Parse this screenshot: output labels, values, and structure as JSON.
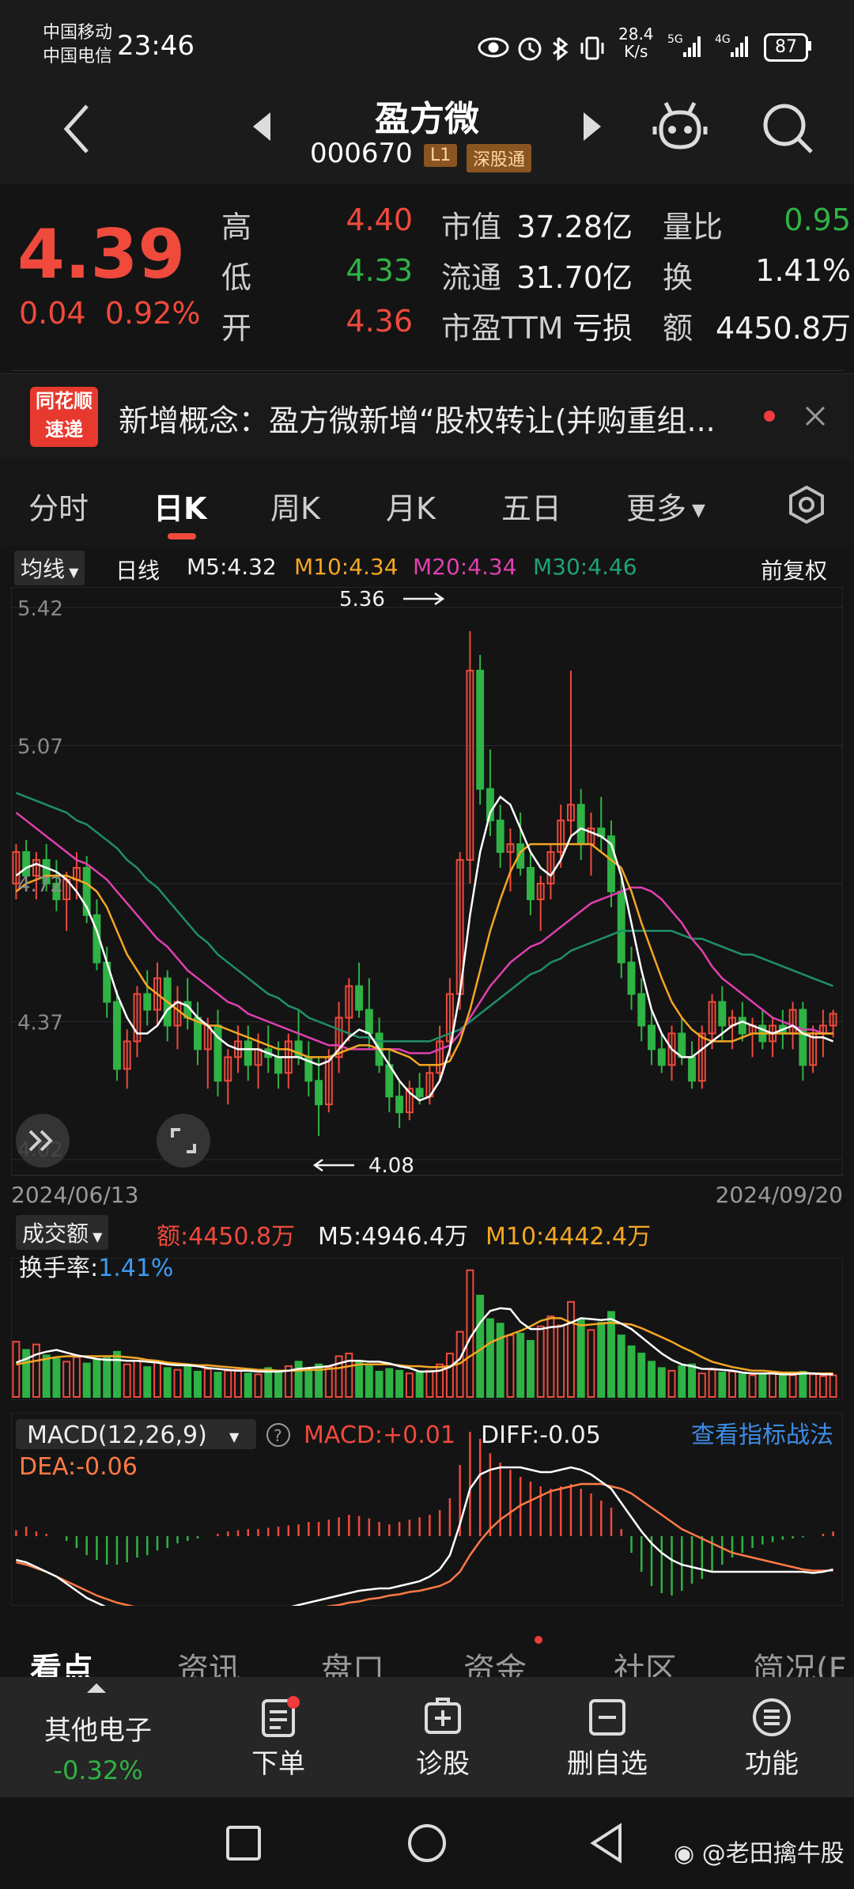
{
  "status_bar": {
    "carrier1": "中国移动",
    "carrier2": "中国电信",
    "time": "23:46",
    "net_speed": "28.4",
    "net_unit": "K/s",
    "sig1": "5G",
    "sig2": "4G",
    "battery": "87"
  },
  "header": {
    "name": "盈方微",
    "code": "000670",
    "tag_level": "L1",
    "tag_market": "深股通"
  },
  "quote": {
    "price": "4.39",
    "change": "0.04",
    "change_pct": "0.92%",
    "high_label": "高",
    "high": "4.40",
    "low_label": "低",
    "low": "4.33",
    "open_label": "开",
    "open": "4.36",
    "mcap_label": "市值",
    "mcap": "37.28亿",
    "float_label": "流通",
    "float": "31.70亿",
    "pe_label": "市盈TTM",
    "pe": "亏损",
    "vr_label": "量比",
    "vr": "0.95",
    "turn_label": "换",
    "turn": "1.41%",
    "amt_label": "额",
    "amt": "4450.8万"
  },
  "news": {
    "logo_top": "同花顺",
    "logo_bottom": "速递",
    "text": "新增概念：盈方微新增“股权转让(并购重组..."
  },
  "tabs": [
    "分时",
    "日K",
    "周K",
    "月K",
    "五日",
    "更多"
  ],
  "ma_legend": {
    "dropdown": "均线",
    "period": "日线",
    "m5": "M5:4.32",
    "m10": "M10:4.34",
    "m20": "M20:4.34",
    "m30": "M30:4.46",
    "adjust": "前复权"
  },
  "colors": {
    "up": "#ef4a3c",
    "down": "#2fb345",
    "m5": "#ffffff",
    "m10": "#f5a623",
    "m20": "#e040b0",
    "m30": "#1f8f6a",
    "link": "#3c8ce7"
  },
  "chart_data": {
    "type": "candlestick",
    "y_ticks": [
      "5.42",
      "5.07",
      "4.72",
      "4.37",
      "4.02"
    ],
    "ylim": [
      4.02,
      5.42
    ],
    "max_label": "5.36",
    "min_label": "4.08",
    "start_date": "2024/06/13",
    "end_date": "2024/09/20",
    "ohlc": [
      [
        4.72,
        4.82,
        4.68,
        4.8
      ],
      [
        4.8,
        4.83,
        4.7,
        4.74
      ],
      [
        4.74,
        4.8,
        4.68,
        4.78
      ],
      [
        4.78,
        4.82,
        4.7,
        4.72
      ],
      [
        4.72,
        4.78,
        4.65,
        4.68
      ],
      [
        4.68,
        4.75,
        4.6,
        4.73
      ],
      [
        4.73,
        4.8,
        4.68,
        4.76
      ],
      [
        4.76,
        4.79,
        4.62,
        4.64
      ],
      [
        4.64,
        4.68,
        4.5,
        4.52
      ],
      [
        4.52,
        4.56,
        4.38,
        4.42
      ],
      [
        4.42,
        4.45,
        4.22,
        4.25
      ],
      [
        4.25,
        4.35,
        4.2,
        4.32
      ],
      [
        4.32,
        4.46,
        4.28,
        4.44
      ],
      [
        4.44,
        4.5,
        4.36,
        4.4
      ],
      [
        4.4,
        4.52,
        4.36,
        4.48
      ],
      [
        4.48,
        4.5,
        4.32,
        4.36
      ],
      [
        4.36,
        4.46,
        4.3,
        4.42
      ],
      [
        4.42,
        4.48,
        4.35,
        4.38
      ],
      [
        4.38,
        4.42,
        4.26,
        4.3
      ],
      [
        4.3,
        4.38,
        4.2,
        4.36
      ],
      [
        4.36,
        4.4,
        4.18,
        4.22
      ],
      [
        4.22,
        4.3,
        4.16,
        4.28
      ],
      [
        4.28,
        4.36,
        4.24,
        4.32
      ],
      [
        4.32,
        4.36,
        4.22,
        4.26
      ],
      [
        4.26,
        4.34,
        4.2,
        4.3
      ],
      [
        4.3,
        4.36,
        4.24,
        4.28
      ],
      [
        4.28,
        4.32,
        4.2,
        4.24
      ],
      [
        4.24,
        4.34,
        4.2,
        4.32
      ],
      [
        4.32,
        4.4,
        4.26,
        4.28
      ],
      [
        4.28,
        4.32,
        4.18,
        4.22
      ],
      [
        4.22,
        4.28,
        4.08,
        4.16
      ],
      [
        4.16,
        4.3,
        4.14,
        4.28
      ],
      [
        4.28,
        4.42,
        4.24,
        4.38
      ],
      [
        4.38,
        4.48,
        4.32,
        4.46
      ],
      [
        4.46,
        4.52,
        4.38,
        4.4
      ],
      [
        4.4,
        4.48,
        4.3,
        4.34
      ],
      [
        4.34,
        4.38,
        4.24,
        4.26
      ],
      [
        4.26,
        4.3,
        4.14,
        4.18
      ],
      [
        4.18,
        4.22,
        4.1,
        4.14
      ],
      [
        4.14,
        4.22,
        4.12,
        4.2
      ],
      [
        4.2,
        4.24,
        4.16,
        4.18
      ],
      [
        4.18,
        4.26,
        4.16,
        4.24
      ],
      [
        4.24,
        4.36,
        4.22,
        4.32
      ],
      [
        4.32,
        4.48,
        4.28,
        4.44
      ],
      [
        4.44,
        4.8,
        4.4,
        4.78
      ],
      [
        4.78,
        5.36,
        4.72,
        5.26
      ],
      [
        5.26,
        5.3,
        4.92,
        4.96
      ],
      [
        4.96,
        5.06,
        4.84,
        4.88
      ],
      [
        4.88,
        4.92,
        4.76,
        4.8
      ],
      [
        4.8,
        4.86,
        4.7,
        4.82
      ],
      [
        4.82,
        4.9,
        4.74,
        4.76
      ],
      [
        4.76,
        4.8,
        4.64,
        4.68
      ],
      [
        4.68,
        4.74,
        4.6,
        4.72
      ],
      [
        4.72,
        4.82,
        4.68,
        4.8
      ],
      [
        4.8,
        4.92,
        4.76,
        4.88
      ],
      [
        4.88,
        5.26,
        4.84,
        4.92
      ],
      [
        4.92,
        4.96,
        4.78,
        4.82
      ],
      [
        4.82,
        4.9,
        4.74,
        4.86
      ],
      [
        4.86,
        4.94,
        4.8,
        4.84
      ],
      [
        4.84,
        4.88,
        4.66,
        4.7
      ],
      [
        4.7,
        4.74,
        4.48,
        4.52
      ],
      [
        4.52,
        4.56,
        4.4,
        4.44
      ],
      [
        4.44,
        4.48,
        4.32,
        4.36
      ],
      [
        4.36,
        4.4,
        4.26,
        4.3
      ],
      [
        4.3,
        4.34,
        4.24,
        4.26
      ],
      [
        4.26,
        4.36,
        4.22,
        4.34
      ],
      [
        4.34,
        4.38,
        4.26,
        4.28
      ],
      [
        4.28,
        4.32,
        4.2,
        4.22
      ],
      [
        4.22,
        4.36,
        4.2,
        4.34
      ],
      [
        4.34,
        4.44,
        4.3,
        4.42
      ],
      [
        4.42,
        4.46,
        4.32,
        4.36
      ],
      [
        4.36,
        4.4,
        4.3,
        4.38
      ],
      [
        4.38,
        4.42,
        4.32,
        4.34
      ],
      [
        4.34,
        4.38,
        4.28,
        4.36
      ],
      [
        4.36,
        4.4,
        4.3,
        4.32
      ],
      [
        4.32,
        4.38,
        4.28,
        4.36
      ],
      [
        4.36,
        4.4,
        4.3,
        4.34
      ],
      [
        4.34,
        4.42,
        4.3,
        4.4
      ],
      [
        4.4,
        4.42,
        4.22,
        4.26
      ],
      [
        4.26,
        4.36,
        4.24,
        4.34
      ],
      [
        4.34,
        4.4,
        4.28,
        4.36
      ],
      [
        4.36,
        4.4,
        4.33,
        4.39
      ]
    ],
    "ma5": [
      4.74,
      4.76,
      4.77,
      4.76,
      4.75,
      4.73,
      4.7,
      4.66,
      4.6,
      4.52,
      4.44,
      4.38,
      4.34,
      4.34,
      4.36,
      4.4,
      4.42,
      4.41,
      4.38,
      4.36,
      4.33,
      4.31,
      4.3,
      4.3,
      4.3,
      4.29,
      4.28,
      4.28,
      4.28,
      4.27,
      4.26,
      4.27,
      4.3,
      4.33,
      4.35,
      4.34,
      4.3,
      4.26,
      4.22,
      4.19,
      4.17,
      4.18,
      4.22,
      4.3,
      4.44,
      4.64,
      4.8,
      4.9,
      4.94,
      4.92,
      4.86,
      4.8,
      4.76,
      4.74,
      4.78,
      4.84,
      4.86,
      4.85,
      4.84,
      4.82,
      4.74,
      4.62,
      4.5,
      4.4,
      4.34,
      4.3,
      4.28,
      4.28,
      4.3,
      4.32,
      4.34,
      4.36,
      4.37,
      4.36,
      4.35,
      4.34,
      4.35,
      4.36,
      4.34,
      4.33,
      4.33,
      4.32
    ],
    "ma10": [
      4.7,
      4.72,
      4.73,
      4.74,
      4.74,
      4.74,
      4.73,
      4.72,
      4.7,
      4.66,
      4.6,
      4.54,
      4.5,
      4.46,
      4.44,
      4.42,
      4.4,
      4.38,
      4.37,
      4.36,
      4.36,
      4.35,
      4.34,
      4.33,
      4.32,
      4.31,
      4.3,
      4.3,
      4.29,
      4.28,
      4.28,
      4.28,
      4.29,
      4.3,
      4.31,
      4.31,
      4.3,
      4.3,
      4.29,
      4.28,
      4.26,
      4.26,
      4.26,
      4.27,
      4.32,
      4.4,
      4.5,
      4.6,
      4.68,
      4.75,
      4.8,
      4.82,
      4.82,
      4.82,
      4.82,
      4.82,
      4.82,
      4.82,
      4.8,
      4.78,
      4.76,
      4.7,
      4.62,
      4.55,
      4.48,
      4.42,
      4.38,
      4.35,
      4.33,
      4.32,
      4.32,
      4.32,
      4.33,
      4.34,
      4.34,
      4.34,
      4.34,
      4.34,
      4.34,
      4.34,
      4.34,
      4.34
    ],
    "ma20": [
      4.9,
      4.88,
      4.86,
      4.84,
      4.82,
      4.8,
      4.78,
      4.77,
      4.75,
      4.73,
      4.7,
      4.67,
      4.64,
      4.61,
      4.58,
      4.56,
      4.53,
      4.5,
      4.48,
      4.46,
      4.44,
      4.42,
      4.41,
      4.39,
      4.38,
      4.37,
      4.36,
      4.35,
      4.34,
      4.33,
      4.32,
      4.31,
      4.31,
      4.3,
      4.3,
      4.3,
      4.3,
      4.3,
      4.3,
      4.29,
      4.29,
      4.29,
      4.3,
      4.31,
      4.34,
      4.38,
      4.42,
      4.46,
      4.49,
      4.52,
      4.54,
      4.56,
      4.57,
      4.59,
      4.61,
      4.63,
      4.65,
      4.67,
      4.68,
      4.69,
      4.7,
      4.71,
      4.71,
      4.7,
      4.68,
      4.65,
      4.62,
      4.58,
      4.55,
      4.51,
      4.48,
      4.46,
      4.44,
      4.42,
      4.4,
      4.38,
      4.37,
      4.36,
      4.35,
      4.35,
      4.34,
      4.34
    ],
    "ma30": [
      4.95,
      4.94,
      4.93,
      4.92,
      4.91,
      4.9,
      4.88,
      4.87,
      4.85,
      4.83,
      4.81,
      4.78,
      4.76,
      4.73,
      4.71,
      4.68,
      4.65,
      4.62,
      4.59,
      4.57,
      4.54,
      4.52,
      4.5,
      4.48,
      4.46,
      4.44,
      4.43,
      4.41,
      4.4,
      4.38,
      4.37,
      4.36,
      4.35,
      4.34,
      4.33,
      4.33,
      4.32,
      4.32,
      4.32,
      4.32,
      4.32,
      4.32,
      4.33,
      4.34,
      4.35,
      4.37,
      4.39,
      4.41,
      4.43,
      4.45,
      4.47,
      4.49,
      4.5,
      4.52,
      4.53,
      4.55,
      4.56,
      4.57,
      4.58,
      4.59,
      4.6,
      4.6,
      4.6,
      4.6,
      4.6,
      4.6,
      4.59,
      4.58,
      4.58,
      4.57,
      4.56,
      4.55,
      4.54,
      4.54,
      4.53,
      4.52,
      4.51,
      4.5,
      4.49,
      4.48,
      4.47,
      4.46
    ]
  },
  "volume": {
    "dropdown": "成交额",
    "amount": "额:4450.8万",
    "m5": "M5:4946.4万",
    "m10": "M10:4442.4万",
    "turnover_label": "换手率:",
    "turnover": "1.41%",
    "values": [
      6.1,
      5.2,
      5.8,
      4.6,
      4.2,
      3.9,
      4.4,
      3.7,
      4.1,
      4.3,
      5.0,
      3.6,
      4.0,
      3.3,
      3.8,
      3.2,
      3.0,
      3.4,
      2.8,
      3.1,
      2.7,
      2.9,
      3.0,
      2.6,
      2.5,
      3.2,
      2.8,
      3.4,
      3.9,
      3.0,
      3.6,
      3.3,
      4.5,
      4.8,
      3.9,
      3.4,
      2.8,
      3.1,
      2.9,
      2.6,
      2.7,
      2.9,
      3.6,
      4.8,
      7.2,
      14.0,
      11.2,
      8.6,
      8.1,
      6.8,
      7.0,
      6.2,
      7.8,
      8.9,
      7.9,
      10.5,
      8.6,
      7.4,
      8.2,
      9.4,
      6.8,
      5.6,
      4.8,
      3.9,
      3.2,
      2.9,
      3.4,
      3.6,
      2.6,
      3.0,
      2.7,
      2.8,
      2.5,
      2.4,
      2.6,
      2.7,
      2.5,
      2.4,
      2.8,
      2.5,
      2.3,
      2.4
    ],
    "ma5": [
      3.8,
      4.2,
      4.7,
      5.0,
      5.2,
      4.9,
      4.6,
      4.4,
      4.2,
      4.1,
      4.1,
      4.0,
      4.0,
      3.9,
      3.8,
      3.6,
      3.5,
      3.5,
      3.4,
      3.2,
      3.1,
      3.0,
      2.9,
      2.9,
      2.8,
      2.8,
      2.8,
      2.9,
      3.1,
      3.2,
      3.3,
      3.4,
      3.7,
      4.0,
      4.0,
      3.9,
      3.9,
      3.7,
      3.4,
      3.2,
      2.8,
      2.8,
      2.9,
      3.3,
      4.2,
      6.5,
      8.2,
      9.5,
      9.8,
      9.7,
      8.3,
      7.5,
      7.5,
      7.7,
      7.8,
      8.2,
      8.7,
      8.6,
      8.5,
      8.6,
      8.1,
      7.5,
      6.6,
      5.7,
      4.8,
      4.1,
      3.6,
      3.4,
      3.1,
      3.1,
      3.0,
      2.9,
      2.7,
      2.6,
      2.6,
      2.6,
      2.5,
      2.5,
      2.6,
      2.6,
      2.5,
      2.5
    ],
    "ma10": [
      3.6,
      3.8,
      4.0,
      4.2,
      4.4,
      4.5,
      4.5,
      4.5,
      4.5,
      4.5,
      4.5,
      4.4,
      4.3,
      4.1,
      4.0,
      3.8,
      3.7,
      3.6,
      3.5,
      3.5,
      3.4,
      3.3,
      3.2,
      3.1,
      3.0,
      3.0,
      2.9,
      2.9,
      2.9,
      3.0,
      3.0,
      3.1,
      3.2,
      3.4,
      3.6,
      3.6,
      3.6,
      3.6,
      3.5,
      3.4,
      3.4,
      3.3,
      3.3,
      3.4,
      3.7,
      4.5,
      5.2,
      6.0,
      6.5,
      6.9,
      7.3,
      7.8,
      8.4,
      8.7,
      8.7,
      8.2,
      7.9,
      8.0,
      8.1,
      8.2,
      8.1,
      8.0,
      7.6,
      7.1,
      6.6,
      6.1,
      5.5,
      5.0,
      4.4,
      3.9,
      3.6,
      3.3,
      3.1,
      2.9,
      2.9,
      2.8,
      2.7,
      2.7,
      2.7,
      2.6,
      2.6,
      2.6
    ]
  },
  "macd": {
    "dropdown": "MACD(12,26,9)",
    "help": "?",
    "macd": "MACD:+0.01",
    "diff": "DIFF:-0.05",
    "dea": "DEA:-0.06",
    "link": "查看指标战法",
    "hist": [
      0.005,
      0.008,
      0.004,
      0.002,
      0.0,
      -0.004,
      -0.01,
      -0.016,
      -0.02,
      -0.024,
      -0.024,
      -0.022,
      -0.018,
      -0.016,
      -0.012,
      -0.01,
      -0.006,
      -0.004,
      -0.002,
      0.0,
      0.002,
      0.004,
      0.005,
      0.006,
      0.006,
      0.007,
      0.008,
      0.009,
      0.01,
      0.012,
      0.012,
      0.014,
      0.016,
      0.018,
      0.017,
      0.015,
      0.012,
      0.01,
      0.012,
      0.014,
      0.016,
      0.018,
      0.022,
      0.032,
      0.06,
      0.088,
      0.082,
      0.07,
      0.062,
      0.056,
      0.05,
      0.046,
      0.042,
      0.04,
      0.042,
      0.044,
      0.04,
      0.036,
      0.03,
      0.024,
      0.006,
      -0.014,
      -0.03,
      -0.042,
      -0.048,
      -0.05,
      -0.046,
      -0.04,
      -0.036,
      -0.03,
      -0.024,
      -0.018,
      -0.014,
      -0.01,
      -0.007,
      -0.005,
      -0.003,
      -0.002,
      -0.001,
      0.0,
      0.002,
      0.004
    ],
    "diff_line": [
      -0.02,
      -0.022,
      -0.026,
      -0.03,
      -0.034,
      -0.04,
      -0.046,
      -0.052,
      -0.056,
      -0.06,
      -0.062,
      -0.062,
      -0.062,
      -0.063,
      -0.063,
      -0.064,
      -0.064,
      -0.065,
      -0.066,
      -0.066,
      -0.066,
      -0.066,
      -0.065,
      -0.064,
      -0.063,
      -0.062,
      -0.061,
      -0.06,
      -0.058,
      -0.056,
      -0.054,
      -0.052,
      -0.05,
      -0.048,
      -0.046,
      -0.045,
      -0.044,
      -0.044,
      -0.042,
      -0.04,
      -0.038,
      -0.034,
      -0.028,
      -0.016,
      0.01,
      0.04,
      0.052,
      0.056,
      0.058,
      0.058,
      0.058,
      0.056,
      0.054,
      0.054,
      0.056,
      0.058,
      0.056,
      0.052,
      0.046,
      0.04,
      0.028,
      0.016,
      0.004,
      -0.006,
      -0.014,
      -0.02,
      -0.024,
      -0.026,
      -0.028,
      -0.03,
      -0.03,
      -0.03,
      -0.03,
      -0.03,
      -0.03,
      -0.03,
      -0.03,
      -0.03,
      -0.03,
      -0.031,
      -0.03,
      -0.028
    ],
    "dea_line": [
      -0.022,
      -0.024,
      -0.027,
      -0.03,
      -0.034,
      -0.038,
      -0.042,
      -0.046,
      -0.05,
      -0.053,
      -0.056,
      -0.058,
      -0.06,
      -0.061,
      -0.062,
      -0.063,
      -0.064,
      -0.065,
      -0.066,
      -0.067,
      -0.067,
      -0.068,
      -0.068,
      -0.068,
      -0.067,
      -0.066,
      -0.065,
      -0.064,
      -0.063,
      -0.062,
      -0.061,
      -0.059,
      -0.058,
      -0.056,
      -0.055,
      -0.053,
      -0.052,
      -0.05,
      -0.049,
      -0.047,
      -0.046,
      -0.044,
      -0.042,
      -0.038,
      -0.03,
      -0.016,
      -0.004,
      0.006,
      0.014,
      0.02,
      0.026,
      0.03,
      0.034,
      0.038,
      0.04,
      0.042,
      0.044,
      0.044,
      0.044,
      0.042,
      0.04,
      0.036,
      0.03,
      0.024,
      0.018,
      0.012,
      0.006,
      0.002,
      -0.002,
      -0.006,
      -0.01,
      -0.014,
      -0.016,
      -0.018,
      -0.02,
      -0.022,
      -0.024,
      -0.026,
      -0.028,
      -0.029,
      -0.029,
      -0.029
    ]
  },
  "info_tabs": [
    "看点",
    "资讯",
    "盘口",
    "资金",
    "社区",
    "简况(F"
  ],
  "bottom_nav": {
    "sector_name": "其他电子",
    "sector_change": "-0.32%",
    "order": "下单",
    "diagnose": "诊股",
    "remove_watch": "删自选",
    "functions": "功能"
  },
  "watermark": "@老田擒牛股"
}
